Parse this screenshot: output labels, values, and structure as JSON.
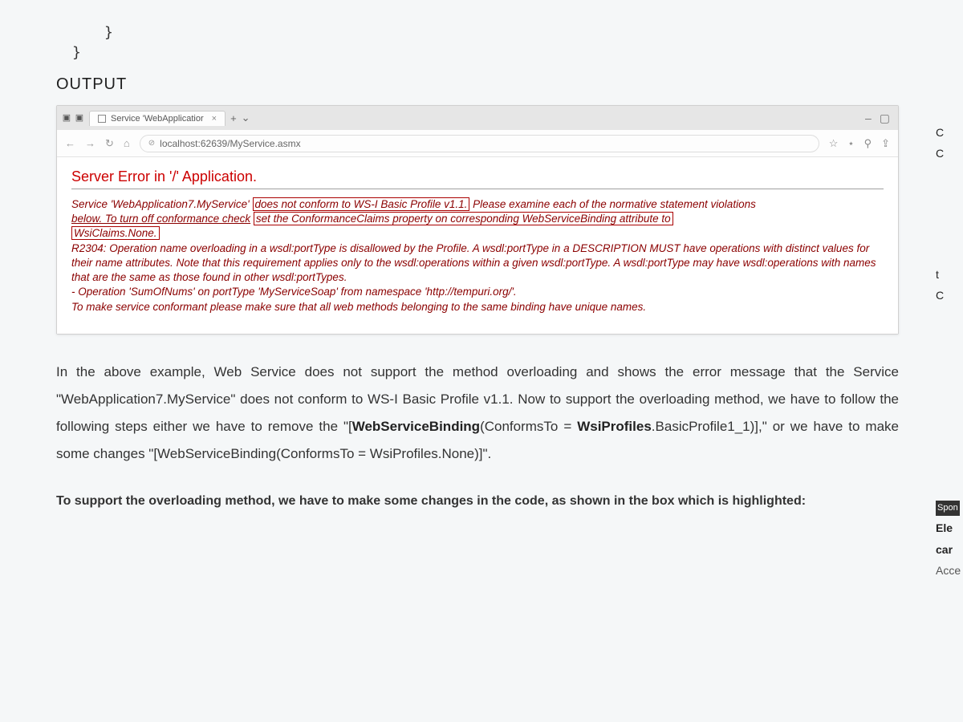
{
  "code": {
    "brace1": "}",
    "brace2": "}"
  },
  "output_heading": "OUTPUT",
  "browser": {
    "tab_title": "Service 'WebApplicatior",
    "tab_close": "×",
    "new_tab": "+",
    "chevron": "⌄",
    "win_min": "–",
    "win_max": "▢",
    "nav_back": "←",
    "nav_fwd": "→",
    "nav_refresh": "↻",
    "nav_home": "⌂",
    "lock": "⊘",
    "url": "localhost:62639/MyService.asmx",
    "star": "☆",
    "star2": "⋆",
    "pin": "⚲",
    "share": "⇪"
  },
  "error": {
    "header": "Server Error in '/' Application.",
    "line1_pre": "Service 'WebApplication7.MyService'",
    "line1_box1": "does not conform to WS-I Basic Profile v1.1.",
    "line1_post": "Please examine each of the normative statement violations",
    "line2_pre": "below. To turn off conformance check",
    "line2_box": "set the ConformanceClaims property on corresponding WebServiceBinding attribute to",
    "line3_box": "WsiClaims.None.",
    "r2304": "R2304: Operation name overloading in a wsdl:portType is disallowed by the Profile. A wsdl:portType in a DESCRIPTION MUST have operations with distinct values for their name attributes. Note that this requirement applies only to the wsdl:operations within a given wsdl:portType. A wsdl:portType may have wsdl:operations with names that are the same as those found in other wsdl:portTypes.",
    "oper": "-  Operation 'SumOfNums' on portType 'MyServiceSoap' from namespace 'http://tempuri.org/'.",
    "conform": "To make service conformant please make sure that all web methods belonging to the same binding have unique names."
  },
  "article": {
    "p1a": "In the above example, Web Service does not support the method overloading and shows the error message that the Service \"WebApplication7.MyService\" does not conform to WS-I Basic Profile v1.1. Now to support the overloading method, we have to follow the following steps either we have to remove the \"[",
    "p1_attr1": "WebServiceBinding",
    "p1b": "(ConformsTo = ",
    "p1_attr2": "WsiProfiles",
    "p1c": ".BasicProfile1_1)],\" or we have to make some changes \"[WebServiceBinding(ConformsTo = WsiProfiles.None)]\".",
    "p2": "To support the overloading method, we have to make some changes in the code, as shown in the box which is highlighted:"
  },
  "side": {
    "spon": "Spon",
    "ele": "Ele",
    "car": "car",
    "acce": "Acce"
  }
}
